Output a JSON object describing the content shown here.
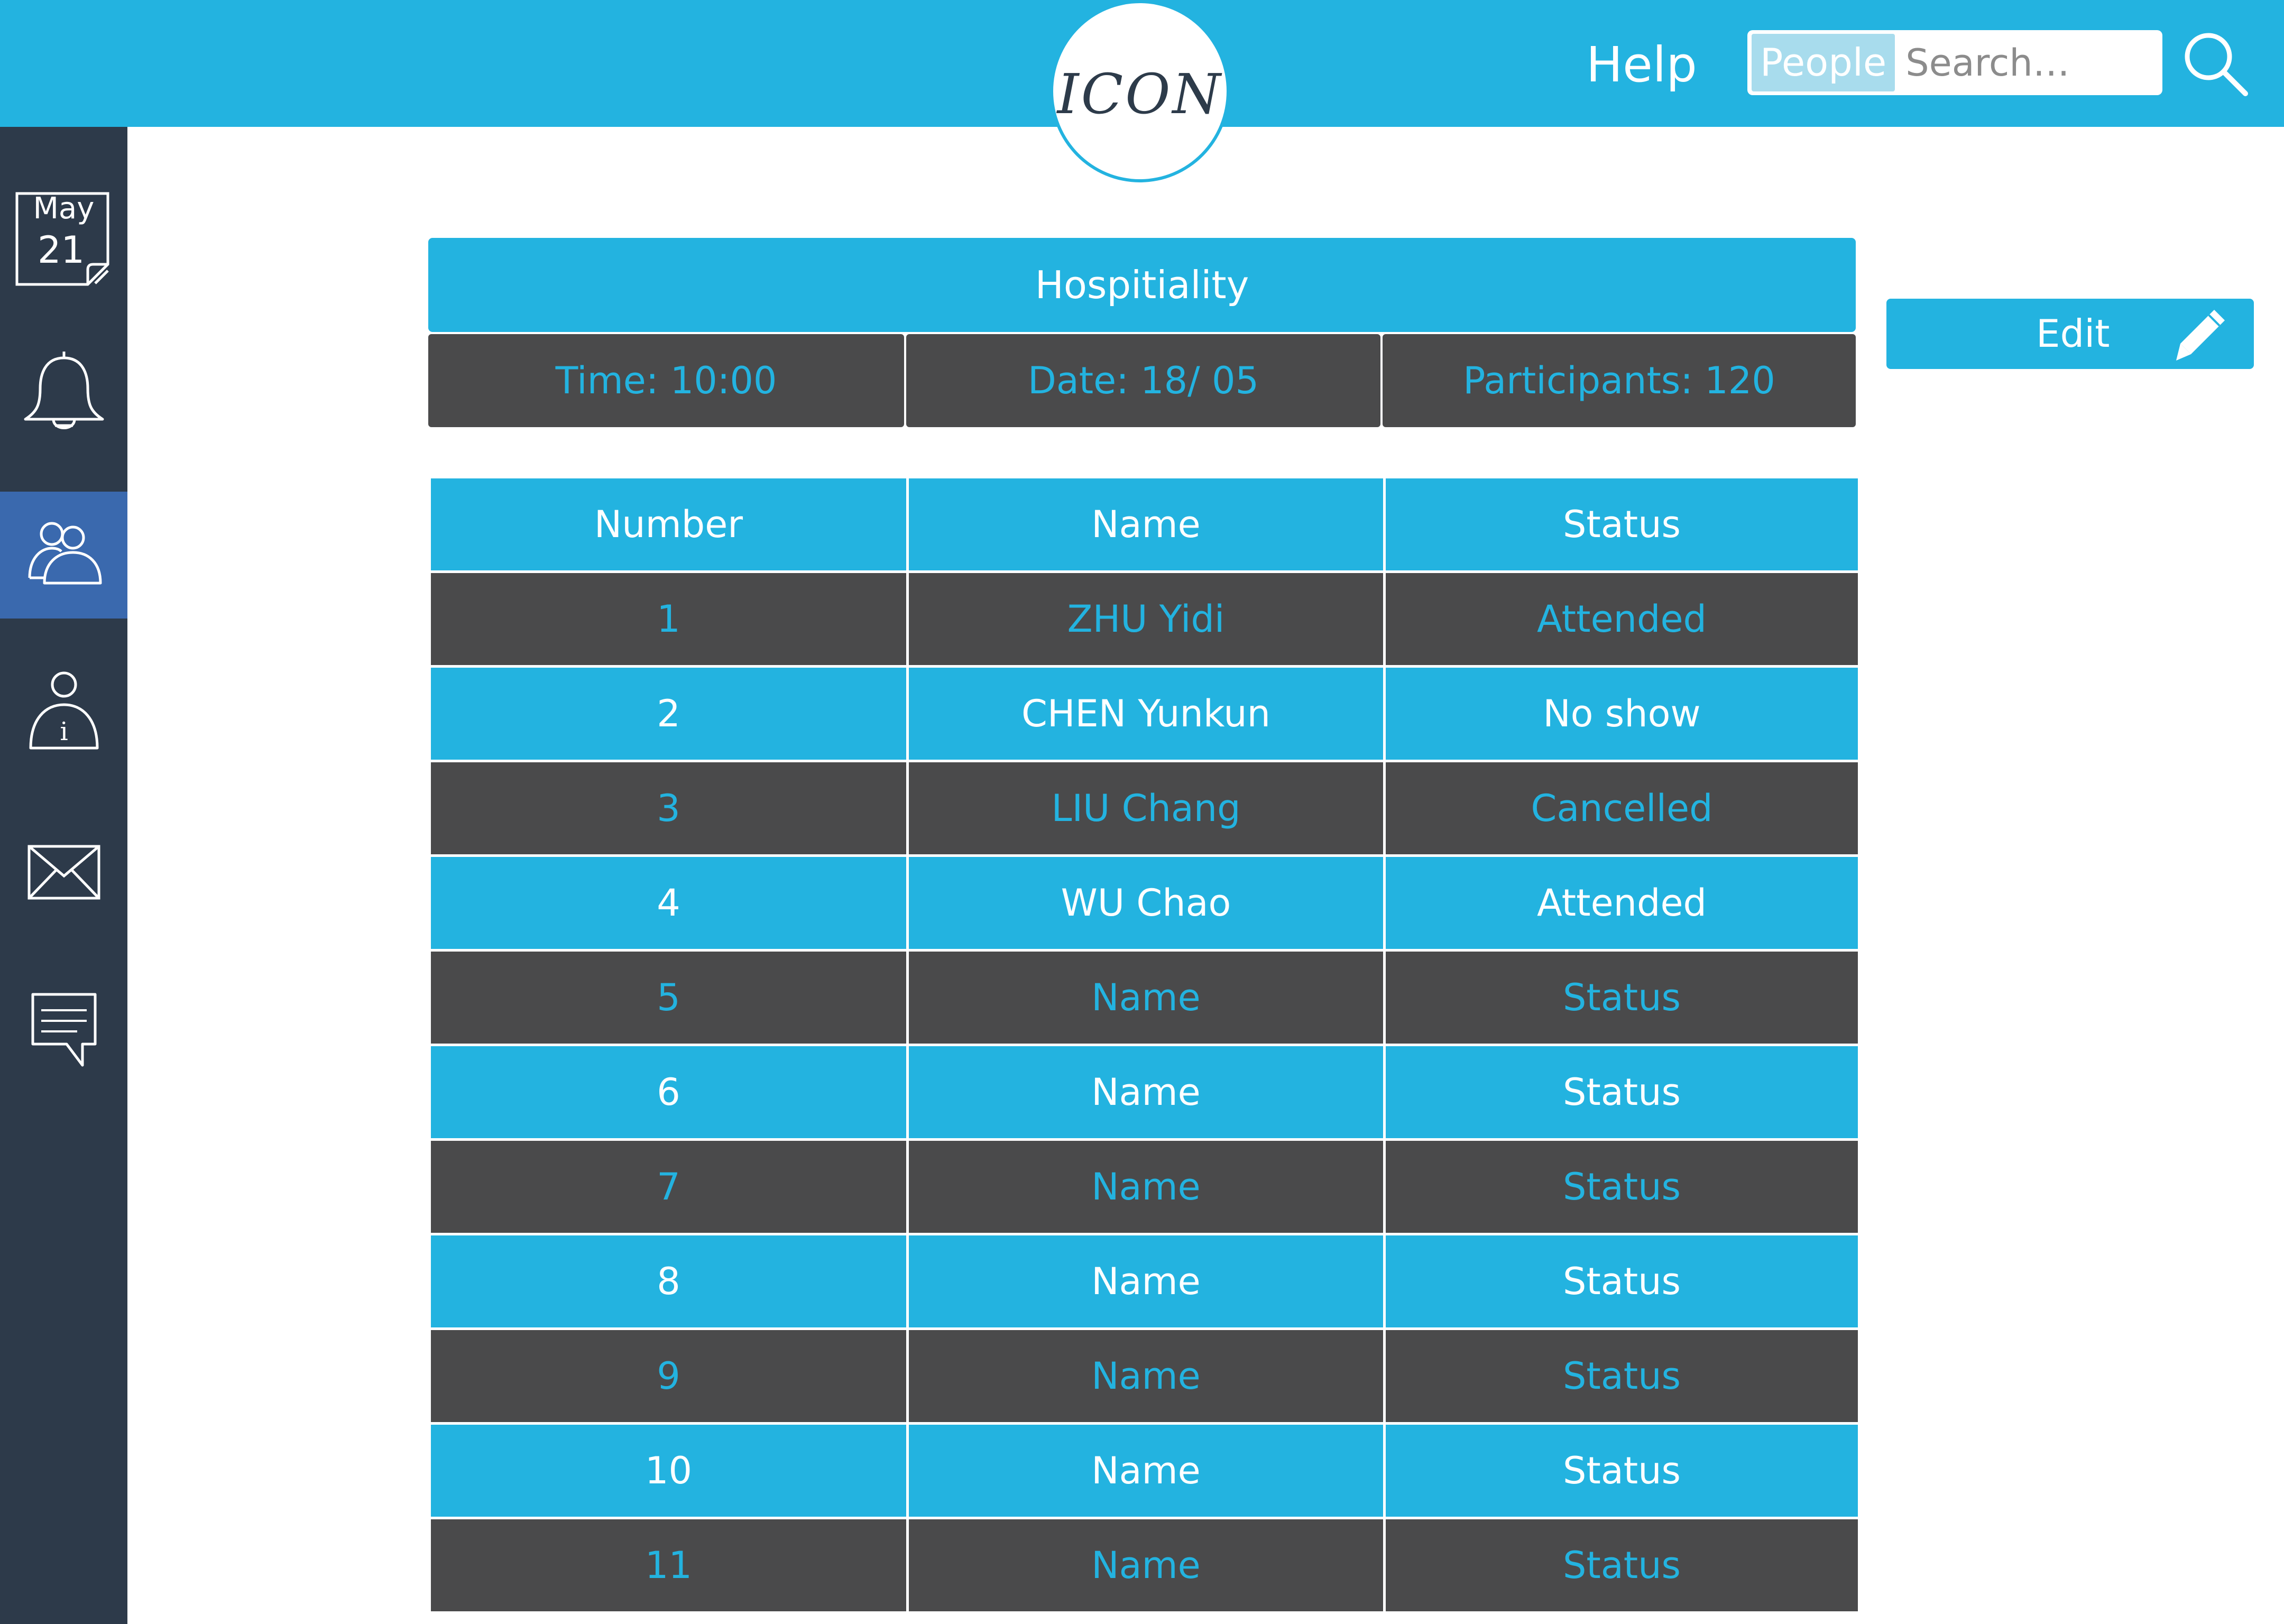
{
  "header": {
    "logo_text": "ICON",
    "help_label": "Help",
    "search_scope": "People",
    "search_placeholder": "Search…"
  },
  "sidebar": {
    "calendar": {
      "month": "May",
      "day": "21"
    },
    "items": [
      {
        "name": "notifications",
        "icon": "bell-icon"
      },
      {
        "name": "people",
        "icon": "people-icon",
        "active": true
      },
      {
        "name": "info",
        "icon": "person-info-icon"
      },
      {
        "name": "mail",
        "icon": "envelope-icon"
      },
      {
        "name": "messages",
        "icon": "chat-bubble-icon"
      }
    ]
  },
  "event": {
    "title": "Hospitiality",
    "time": "Time: 10:00",
    "date": "Date: 18/ 05",
    "participants": "Participants: 120"
  },
  "edit_label": "Edit",
  "table": {
    "headers": [
      "Number",
      "Name",
      "Status"
    ],
    "rows": [
      [
        "1",
        "ZHU Yidi",
        "Attended"
      ],
      [
        "2",
        "CHEN Yunkun",
        "No show"
      ],
      [
        "3",
        "LIU Chang",
        "Cancelled"
      ],
      [
        "4",
        "WU Chao",
        "Attended"
      ],
      [
        "5",
        "Name",
        "Status"
      ],
      [
        "6",
        "Name",
        "Status"
      ],
      [
        "7",
        "Name",
        "Status"
      ],
      [
        "8",
        "Name",
        "Status"
      ],
      [
        "9",
        "Name",
        "Status"
      ],
      [
        "10",
        "Name",
        "Status"
      ],
      [
        "11",
        "Name",
        "Status"
      ]
    ]
  },
  "colors": {
    "accent": "#23b3e0",
    "dark_row": "#4a4a4b",
    "sidebar": "#2d3a4a",
    "sidebar_active": "#3a69ae"
  }
}
